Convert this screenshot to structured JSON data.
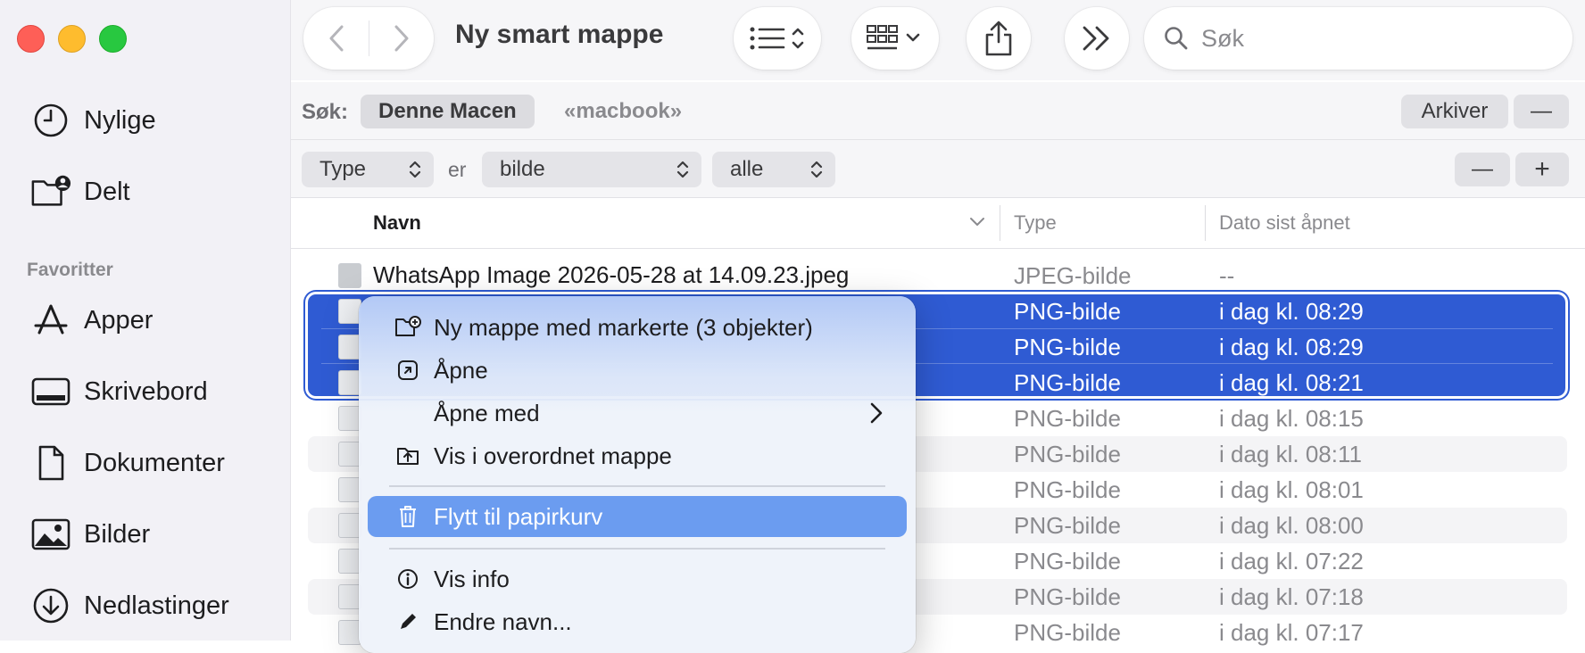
{
  "window": {
    "title": "Ny smart mappe"
  },
  "sidebar": {
    "items_top": [
      {
        "label": "Nylige",
        "icon": "clock-icon"
      },
      {
        "label": "Delt",
        "icon": "shared-folder-icon"
      }
    ],
    "favorites_header": "Favoritter",
    "favorites": [
      {
        "label": "Apper",
        "icon": "applications-icon"
      },
      {
        "label": "Skrivebord",
        "icon": "desktop-icon"
      },
      {
        "label": "Dokumenter",
        "icon": "document-icon"
      },
      {
        "label": "Bilder",
        "icon": "pictures-icon"
      },
      {
        "label": "Nedlastinger",
        "icon": "downloads-icon"
      }
    ]
  },
  "toolbar": {
    "search_placeholder": "Søk"
  },
  "scope": {
    "label": "Søk:",
    "this_mac": "Denne Macen",
    "macbook": "«macbook»",
    "save_label": "Arkiver",
    "remove_label": "—"
  },
  "criteria": {
    "attribute": "Type",
    "operator": "er",
    "value": "bilde",
    "scope": "alle",
    "minus": "—",
    "plus": "+"
  },
  "columns": {
    "name": "Navn",
    "type": "Type",
    "date": "Dato sist åpnet"
  },
  "rows": [
    {
      "name": "WhatsApp Image 2026-05-28 at 14.09.23.jpeg",
      "type": "JPEG-bilde",
      "date": "--"
    },
    {
      "name": "",
      "type": "PNG-bilde",
      "date": "i dag kl. 08:29"
    },
    {
      "name": "",
      "type": "PNG-bilde",
      "date": "i dag kl. 08:29"
    },
    {
      "name": "",
      "type": "PNG-bilde",
      "date": "i dag kl. 08:21"
    },
    {
      "name": "",
      "type": "PNG-bilde",
      "date": "i dag kl. 08:15"
    },
    {
      "name": "",
      "type": "PNG-bilde",
      "date": "i dag kl. 08:11"
    },
    {
      "name": "",
      "type": "PNG-bilde",
      "date": "i dag kl. 08:01"
    },
    {
      "name": "",
      "type": "PNG-bilde",
      "date": "i dag kl. 08:00"
    },
    {
      "name": "",
      "type": "PNG-bilde",
      "date": "i dag kl. 07:22"
    },
    {
      "name": "",
      "type": "PNG-bilde",
      "date": "i dag kl. 07:18"
    },
    {
      "name": "",
      "type": "PNG-bilde",
      "date": "i dag kl. 07:17"
    }
  ],
  "context_menu": {
    "items": [
      {
        "label": "Ny mappe med markerte (3 objekter)",
        "icon": "new-folder-icon"
      },
      {
        "label": "Åpne",
        "icon": "open-icon"
      },
      {
        "label": "Åpne med",
        "icon": ""
      },
      {
        "label": "Vis i overordnet mappe",
        "icon": "enclosing-folder-icon"
      },
      {
        "label": "Flytt til papirkurv",
        "icon": "trash-icon"
      },
      {
        "label": "Vis info",
        "icon": "info-icon"
      },
      {
        "label": "Endre navn...",
        "icon": "pencil-icon"
      }
    ]
  },
  "colors": {
    "selection": "#2f5bd3",
    "menu_highlight": "#6b9cf0"
  }
}
